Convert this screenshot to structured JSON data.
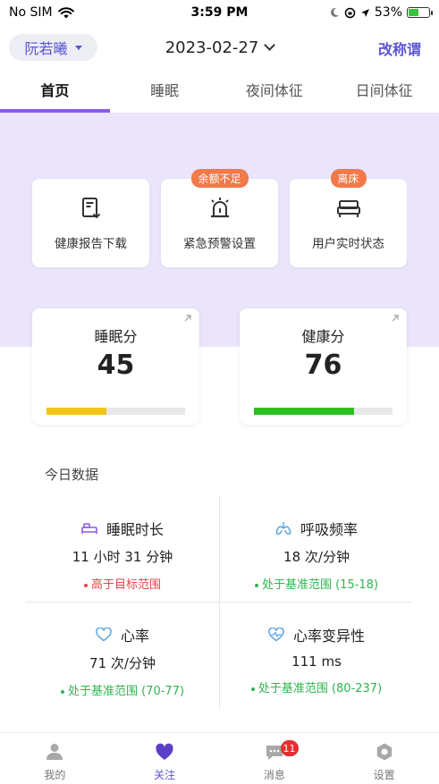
{
  "status_bar": {
    "carrier": "No SIM",
    "time": "3:59 PM",
    "battery_percent": "53%",
    "battery_level": 0.53
  },
  "header": {
    "user_name": "阮若曦",
    "date": "2023-02-27",
    "rename_label": "改称谓"
  },
  "tabs": [
    {
      "label": "首页",
      "active": true
    },
    {
      "label": "睡眠",
      "active": false
    },
    {
      "label": "夜间体征",
      "active": false
    },
    {
      "label": "日间体征",
      "active": false
    }
  ],
  "actions": [
    {
      "label": "健康报告下载",
      "icon": "report-download-icon",
      "badge": ""
    },
    {
      "label": "紧急预警设置",
      "icon": "alarm-icon",
      "badge": "余额不足"
    },
    {
      "label": "用户实时状态",
      "icon": "bed-icon",
      "badge": "离床"
    }
  ],
  "scores": {
    "sleep": {
      "title": "睡眠分",
      "value": "45",
      "fraction": 0.43,
      "color": "#f0c419"
    },
    "health": {
      "title": "健康分",
      "value": "76",
      "fraction": 0.72,
      "color": "#2ebf1f"
    }
  },
  "today": {
    "title": "今日数据",
    "metrics": [
      {
        "name": "睡眠时长",
        "icon": "bed-icon",
        "value": "11 小时 31 分钟",
        "note": "高于目标范围",
        "status": "red"
      },
      {
        "name": "呼吸频率",
        "icon": "lungs-icon",
        "value": "18 次/分钟",
        "note": "处于基准范围 (15-18)",
        "status": "green"
      },
      {
        "name": "心率",
        "icon": "heart-icon",
        "value": "71 次/分钟",
        "note": "处于基准范围 (70-77)",
        "status": "green"
      },
      {
        "name": "心率变异性",
        "icon": "heart-pulse-icon",
        "value": "111 ms",
        "note": "处于基准范围 (80-237)",
        "status": "green"
      }
    ]
  },
  "bottom_nav": [
    {
      "label": "我的",
      "icon": "person-icon",
      "active": false,
      "badge": ""
    },
    {
      "label": "关注",
      "icon": "heart-icon",
      "active": true,
      "badge": ""
    },
    {
      "label": "消息",
      "icon": "chat-icon",
      "active": false,
      "badge": "11"
    },
    {
      "label": "设置",
      "icon": "gear-icon",
      "active": false,
      "badge": ""
    }
  ],
  "colors": {
    "accent": "#5b53d6",
    "tab_underline": "#8a5be6",
    "purple_bg": "#ebe5fb",
    "badge_orange": "#f07a4a",
    "status_red": "#e8434a",
    "status_green": "#2fb64f"
  }
}
